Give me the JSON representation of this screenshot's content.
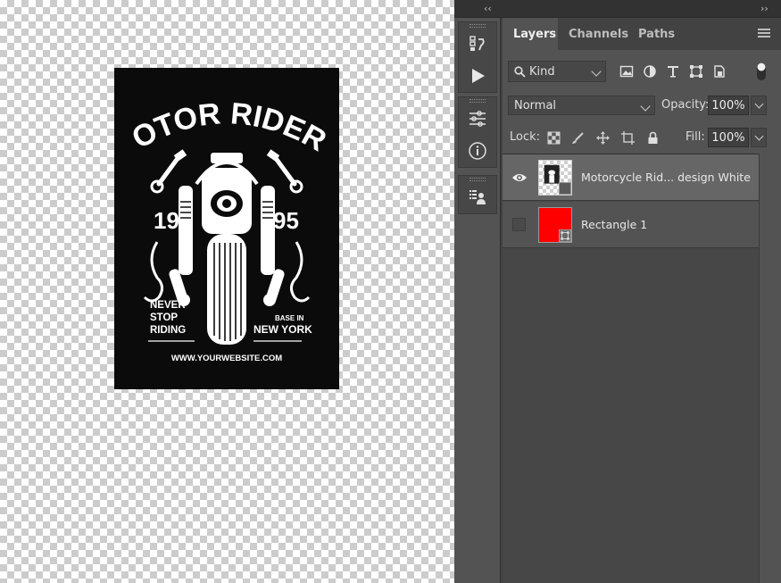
{
  "artwork": {
    "title": "MOTOR RIDERS",
    "year_left": "19",
    "year_right": "95",
    "slogan_lines": [
      "NEVER",
      "STOP",
      "RIDING"
    ],
    "base_small": "BASE IN",
    "base_city": "NEW YORK",
    "website": "WWW.YOURWEBSITE.COM"
  },
  "collapse": {
    "left": "‹‹",
    "right": "››"
  },
  "tool_strip": {
    "icons": [
      "history-icon",
      "play-action-icon",
      "properties-icon",
      "info-icon",
      "layer-comps-icon"
    ]
  },
  "tabs": [
    {
      "label": "Layers",
      "active": true
    },
    {
      "label": "Channels",
      "active": false
    },
    {
      "label": "Paths",
      "active": false
    }
  ],
  "filter": {
    "kind_label": "Kind",
    "icons": [
      "pixel-layer-filter-icon",
      "adjustment-layer-filter-icon",
      "type-layer-filter-icon",
      "shape-layer-filter-icon",
      "smart-object-filter-icon"
    ]
  },
  "blend": {
    "mode": "Normal",
    "opacity_label": "Opacity:",
    "opacity_value": "100%"
  },
  "lock": {
    "label": "Lock:",
    "icons": [
      "lock-transparent-pixels-icon",
      "lock-image-pixels-icon",
      "lock-position-icon",
      "lock-artboard-icon",
      "lock-all-icon"
    ],
    "fill_label": "Fill:",
    "fill_value": "100%"
  },
  "layers": [
    {
      "name": "Motorcycle Rid... design White",
      "visible": true,
      "selected": true,
      "thumb": "smart-object"
    },
    {
      "name": "Rectangle 1",
      "visible": false,
      "selected": false,
      "thumb": "red-shape",
      "color": "#ff0000"
    }
  ],
  "colors": {
    "panel_bg": "#535353",
    "canvas_art_bg": "#0b0b0b",
    "rectangle_fill": "#ff0000"
  }
}
